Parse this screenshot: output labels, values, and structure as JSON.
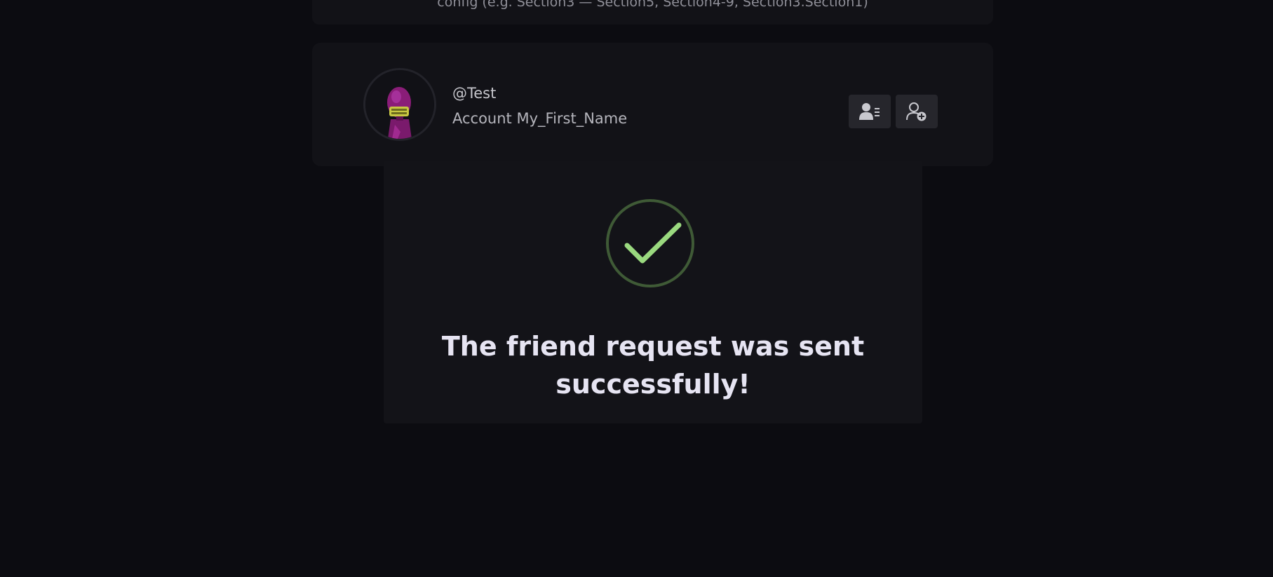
{
  "background_card": {
    "text": "config (e.g. Section3 — Section5, Section4-9, Section3.Section1)"
  },
  "user_card": {
    "username": "@Test",
    "account_name": "Account My_First_Name",
    "buttons": [
      {
        "icon": "user-profile-list-icon",
        "label": ""
      },
      {
        "icon": "user-add-icon",
        "label": ""
      }
    ]
  },
  "modal": {
    "icon": "checkmark-circle-icon",
    "message": "The friend request was sent successfully!"
  },
  "colors": {
    "background": "#0c0c11",
    "card": "#121217",
    "modal": "#131318",
    "success_green": "#9ad97f",
    "success_ring": "#3f5a36",
    "avatar_purple": "#8a1d78",
    "avatar_yellow": "#c8c842"
  }
}
